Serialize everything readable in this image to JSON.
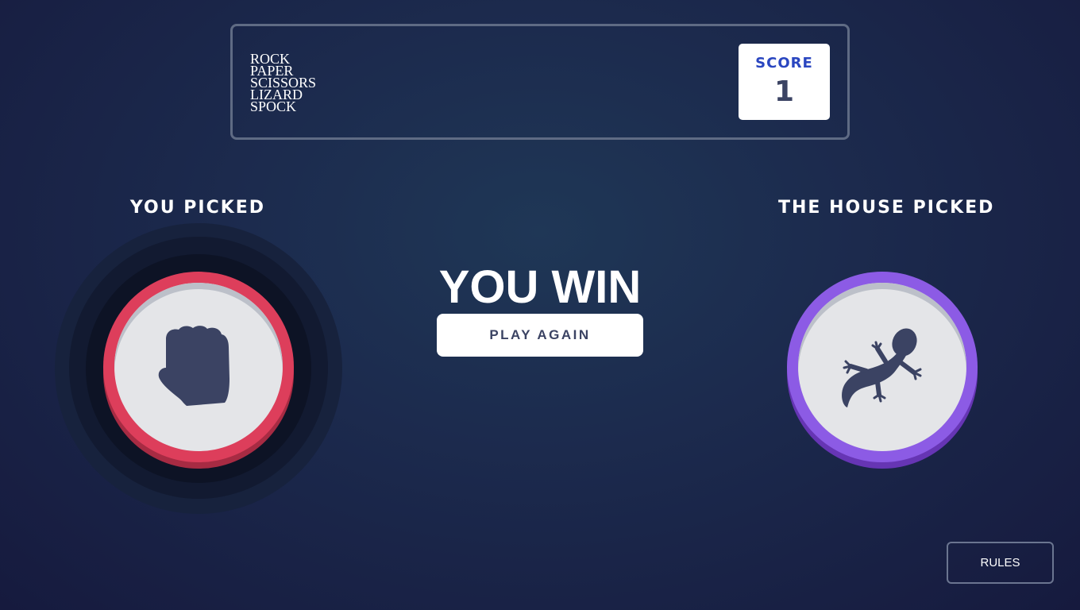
{
  "header": {
    "title_lines": [
      "ROCK",
      "PAPER",
      "SCISSORS",
      "LIZARD",
      "SPOCK"
    ],
    "score_label": "SCORE",
    "score_value": "1"
  },
  "player": {
    "label": "YOU PICKED",
    "choice": "rock",
    "icon": "rock-fist-icon",
    "ring_color": "#dd3e5b",
    "winner_halo": true
  },
  "house": {
    "label": "THE HOUSE PICKED",
    "choice": "lizard",
    "icon": "lizard-icon",
    "ring_color": "#8c5be5"
  },
  "result": {
    "text": "YOU WIN",
    "play_again_label": "PLAY AGAIN"
  },
  "footer": {
    "rules_label": "RULES"
  }
}
